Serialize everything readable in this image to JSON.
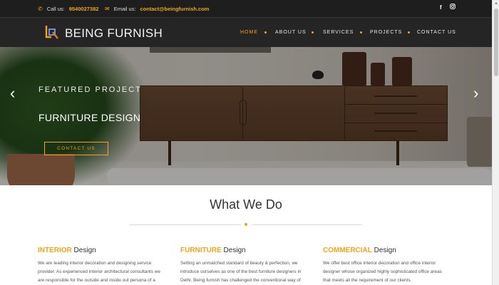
{
  "topbar": {
    "phone_label": "Call us:",
    "phone": "9540027382",
    "email_label": "Email us:",
    "email": "contact@beingfurnish.com",
    "social": [
      "facebook-icon",
      "instagram-icon"
    ]
  },
  "header": {
    "brand": "BEING FURNISH",
    "nav": [
      "HOME",
      "ABOUT US",
      "SERVICES",
      "PROJECTS",
      "CONTACT US"
    ],
    "active_nav": "HOME"
  },
  "hero": {
    "eyebrow": "FEATURED PROJECT",
    "title": "FURNITURE DESIGN",
    "button": "CONTACT US",
    "prev_icon": "chevron-left-icon",
    "next_icon": "chevron-right-icon"
  },
  "section": {
    "title": "What We Do"
  },
  "services": [
    {
      "highlight": "INTERIOR",
      "rest": " Design",
      "lines": [
        "We are leading interior decoration and designing service",
        "provider. As experienced interior architectural consultants we",
        "are responsible for the outside and inside out persona of a"
      ]
    },
    {
      "highlight": "FURNITURE",
      "rest": " Design",
      "lines": [
        "Setting an unmatched standard of beauty & perfection, we",
        "introduce ourselves as one of the best furniture designers in",
        "Delhi. Being furnish has challenged the conventional way of"
      ]
    },
    {
      "highlight": "COMMERCIAL",
      "rest": " Design",
      "lines": [
        "We offer best office interior decoration and office interior",
        "designer whose organized highly sophisticated office areas",
        "that meets all the requirement of our clients."
      ]
    }
  ],
  "colors": {
    "accent": "#f0a41b",
    "topbar_bg": "#1e1e1e",
    "header_bg": "#252525"
  }
}
